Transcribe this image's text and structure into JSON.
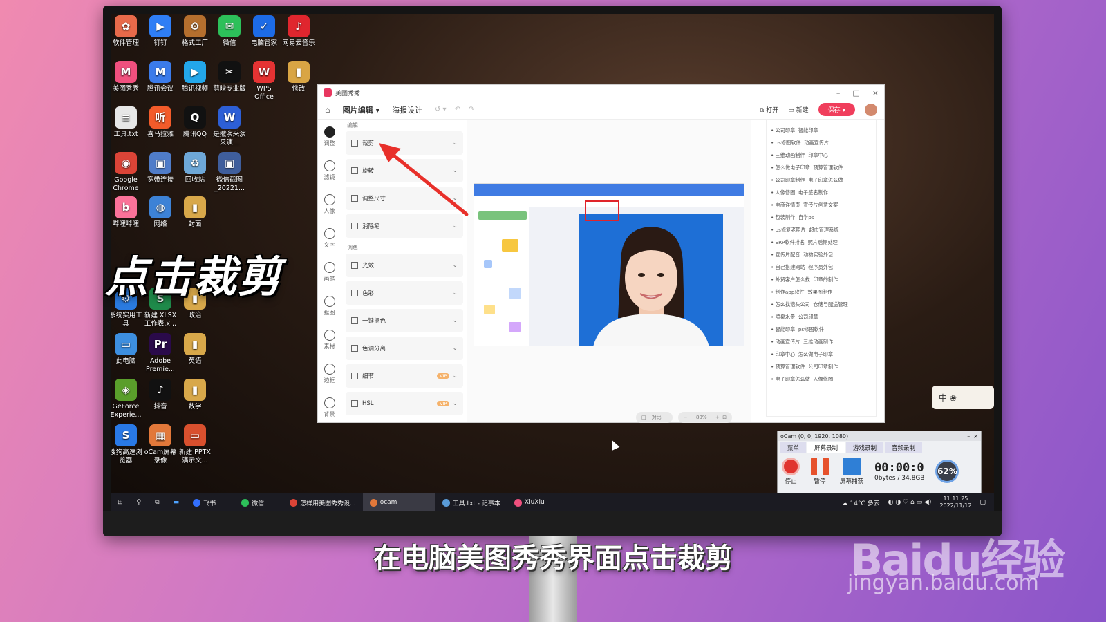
{
  "desktop_icons": [
    {
      "label": "软件管理",
      "color": "#e86a4a",
      "glyph": "✿"
    },
    {
      "label": "钉钉",
      "color": "#2f7ef5",
      "glyph": "▶"
    },
    {
      "label": "格式工厂",
      "color": "#b56f2e",
      "glyph": "⚙"
    },
    {
      "label": "微信",
      "color": "#2dc05a",
      "glyph": "✉"
    },
    {
      "label": "电脑管家",
      "color": "#1d6be6",
      "glyph": "✓"
    },
    {
      "label": "网易云音乐",
      "color": "#e0262e",
      "glyph": "♪"
    },
    {
      "label": "美图秀秀",
      "color": "#f0507e",
      "glyph": "M"
    },
    {
      "label": "腾讯会议",
      "color": "#3b7bea",
      "glyph": "M"
    },
    {
      "label": "腾讯视频",
      "color": "#23a7ea",
      "glyph": "▶"
    },
    {
      "label": "剪映专业版",
      "color": "#111111",
      "glyph": "✂"
    },
    {
      "label": "WPS Office",
      "color": "#e53333",
      "glyph": "W"
    },
    {
      "label": "修改",
      "color": "#d9a544",
      "glyph": "▮"
    },
    {
      "label": "工具.txt",
      "color": "#e7e7e7",
      "glyph": "≡"
    },
    {
      "label": "喜马拉雅",
      "color": "#f35b2a",
      "glyph": "听"
    },
    {
      "label": "腾讯QQ",
      "color": "#111111",
      "glyph": "Q"
    },
    {
      "label": "是撤演采演采演...",
      "color": "#2d5fd6",
      "glyph": "W"
    },
    {
      "label": "Google Chrome",
      "color": "#db4437",
      "glyph": "◉"
    },
    {
      "label": "宽带连接",
      "color": "#4f7cc9",
      "glyph": "▣"
    },
    {
      "label": "回收站",
      "color": "#6ea8d8",
      "glyph": "♻"
    },
    {
      "label": "微信截图_20221...",
      "color": "#3f5e9c",
      "glyph": "▣"
    },
    {
      "label": "哔哩哔哩",
      "color": "#fb7299",
      "glyph": "b"
    },
    {
      "label": "网络",
      "color": "#3d82d6",
      "glyph": "◍"
    },
    {
      "label": "封面",
      "color": "#d8a84a",
      "glyph": "▮"
    },
    {
      "label": "系统实用工具",
      "color": "#2a7be0",
      "glyph": "⚙"
    },
    {
      "label": "新建 XLSX 工作表.x...",
      "color": "#1f8a4a",
      "glyph": "S"
    },
    {
      "label": "政治",
      "color": "#d8a84a",
      "glyph": "▮"
    },
    {
      "label": "此电脑",
      "color": "#3d8fe0",
      "glyph": "▭"
    },
    {
      "label": "Adobe Premie...",
      "color": "#2a0a4a",
      "glyph": "Pr"
    },
    {
      "label": "英语",
      "color": "#d8a84a",
      "glyph": "▮"
    },
    {
      "label": "GeForce Experie...",
      "color": "#5a9e2b",
      "glyph": "◈"
    },
    {
      "label": "抖音",
      "color": "#111111",
      "glyph": "♪"
    },
    {
      "label": "数学",
      "color": "#d8a84a",
      "glyph": "▮"
    },
    {
      "label": "搜狗高速浏览器",
      "color": "#2979e6",
      "glyph": "S"
    },
    {
      "label": "oCam屏幕录像",
      "color": "#e2783a",
      "glyph": "▦"
    },
    {
      "label": "新建 PPTX 演示文...",
      "color": "#d9502e",
      "glyph": "▭"
    }
  ],
  "big_caption": "点击裁剪",
  "subtitle": "在电脑美图秀秀界面点击裁剪",
  "watermark": {
    "logo": "Baidu经验",
    "url": "jingyan.baidu.com"
  },
  "app": {
    "title": "美图秀秀",
    "tabs": [
      "图片编辑",
      "海报设计"
    ],
    "open_label": "打开",
    "new_label": "新建",
    "save_label": "保存",
    "sidebar": [
      {
        "label": "调整",
        "icon": "sliders-icon"
      },
      {
        "label": "滤镜",
        "icon": "filter-icon"
      },
      {
        "label": "人像",
        "icon": "portrait-icon"
      },
      {
        "label": "文字",
        "icon": "text-icon"
      },
      {
        "label": "画笔",
        "icon": "brush-icon"
      },
      {
        "label": "抠图",
        "icon": "cutout-icon"
      },
      {
        "label": "素材",
        "icon": "sticker-icon"
      },
      {
        "label": "边框",
        "icon": "frame-icon"
      },
      {
        "label": "背景",
        "icon": "background-icon"
      }
    ],
    "edit_section": "编辑",
    "color_section": "调色",
    "edit_tools": [
      "裁剪",
      "旋转",
      "调整尺寸",
      "消除笔"
    ],
    "color_tools": [
      {
        "label": "光效",
        "vip": false
      },
      {
        "label": "色彩",
        "vip": false
      },
      {
        "label": "一键抠色",
        "vip": false
      },
      {
        "label": "色调分离",
        "vip": false
      },
      {
        "label": "细节",
        "vip": true
      },
      {
        "label": "HSL",
        "vip": true
      }
    ],
    "vip_label": "VIP",
    "compare_label": "对比",
    "zoom_label": "80%",
    "keywords": [
      [
        "公司印章",
        "智能印章"
      ],
      [
        "ps修图软件",
        "动画宣传片"
      ],
      [
        "三维动画制作",
        "印章中心"
      ],
      [
        "怎么做电子印章",
        "预算管理软件"
      ],
      [
        "公司印章制作",
        "电子印章怎么做"
      ],
      [
        "人像修图",
        "电子签名制作"
      ],
      [
        "电商详情页",
        "宣传片创意文案"
      ],
      [
        "包装制作",
        "自学ps"
      ],
      [
        "ps修复老照片",
        "超市管理系统"
      ],
      [
        "ERP软件排名",
        "照片后期处理"
      ],
      [
        "宣传片配音",
        "动物实验外包"
      ],
      [
        "自己搭建网站",
        "程序员外包"
      ],
      [
        "外贸客户怎么找",
        "印章的制作"
      ],
      [
        "制作app软件",
        "效果图制作"
      ],
      [
        "怎么找猎头公司",
        "仓储与配送管理"
      ],
      [
        "喷泉水景",
        "公司印章"
      ],
      [
        "智能印章",
        "ps修图软件"
      ],
      [
        "动画宣传片",
        "三维动画制作"
      ],
      [
        "印章中心",
        "怎么做电子印章"
      ],
      [
        "预算管理软件",
        "公司印章制作"
      ],
      [
        "电子印章怎么做",
        "人像修图"
      ]
    ]
  },
  "taskbar": {
    "items": [
      {
        "label": "飞书",
        "color": "#3370ff"
      },
      {
        "label": "微信",
        "color": "#2dc05a"
      },
      {
        "label": "怎样用美图秀秀设...",
        "color": "#db4437"
      },
      {
        "label": "ocam",
        "color": "#e2783a"
      },
      {
        "label": "工具.txt - 记事本",
        "color": "#5a9bd8"
      },
      {
        "label": "XiuXiu",
        "color": "#f0507e"
      }
    ],
    "weather": "14°C 多云",
    "time": "11:11:25",
    "date": "2022/11/12"
  },
  "ocam": {
    "title": "oCam (0, 0, 1920, 1080)",
    "tabs": [
      "菜单",
      "屏幕录制",
      "游戏录制",
      "音频录制"
    ],
    "stop": "停止",
    "pause": "暂停",
    "capture": "屏幕捕获",
    "time": "00:00:0",
    "size": "0bytes / 34.8GB",
    "gauge": "62"
  },
  "ime": "中 ❀"
}
